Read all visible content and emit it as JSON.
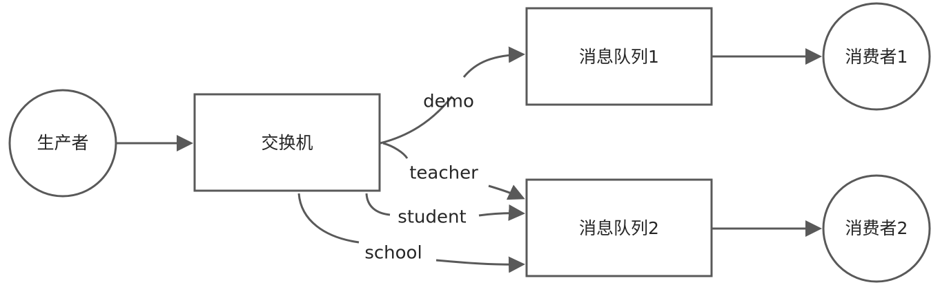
{
  "diagram": {
    "nodes": {
      "producer": "生产者",
      "exchange": "交换机",
      "queue1": "消息队列1",
      "queue2": "消息队列2",
      "consumer1": "消费者1",
      "consumer2": "消费者2"
    },
    "edge_labels": {
      "demo": "demo",
      "teacher": "teacher",
      "student": "student",
      "school": "school"
    },
    "colors": {
      "stroke": "#595959",
      "text": "#262626",
      "background": "#ffffff"
    }
  }
}
